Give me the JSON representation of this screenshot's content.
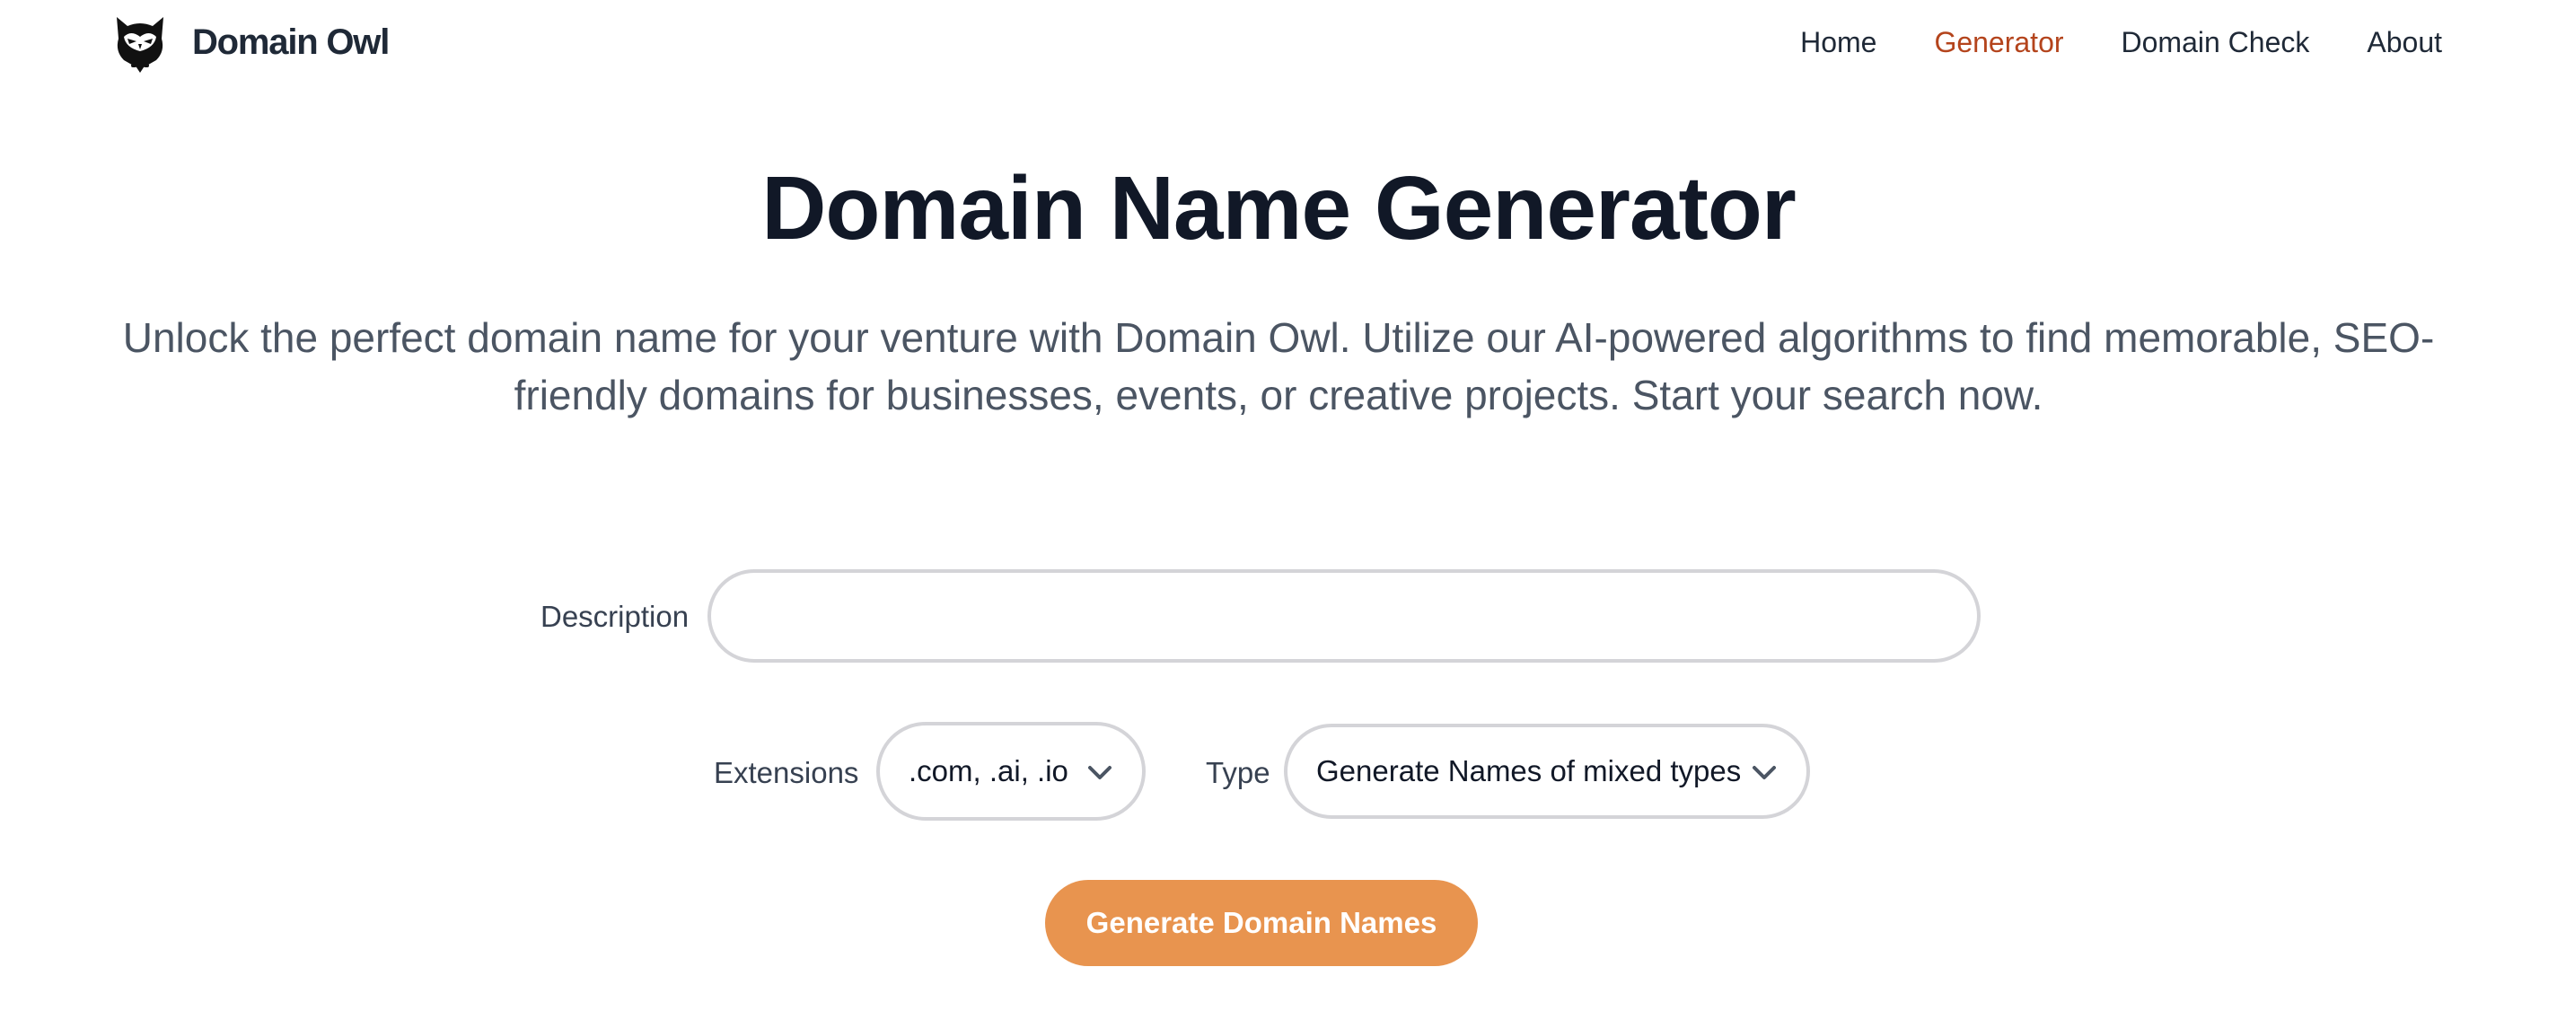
{
  "header": {
    "brand_name": "Domain Owl",
    "logo_icon": "owl-icon",
    "nav": [
      {
        "label": "Home",
        "active": false
      },
      {
        "label": "Generator",
        "active": true
      },
      {
        "label": "Domain Check",
        "active": false
      },
      {
        "label": "About",
        "active": false
      }
    ]
  },
  "hero": {
    "title": "Domain Name Generator",
    "subtitle": "Unlock the perfect domain name for your venture with Domain Owl. Utilize our AI-powered algorithms to find memorable, SEO-friendly domains for businesses, events, or creative projects. Start your search now."
  },
  "form": {
    "description_label": "Description",
    "description_value": "",
    "description_placeholder": "",
    "extensions_label": "Extensions",
    "extensions_value": ".com, .ai, .io",
    "type_label": "Type",
    "type_value": "Generate Names of mixed types",
    "submit_label": "Generate Domain Names"
  },
  "colors": {
    "accent": "#e8944f",
    "nav_active": "#b4441c",
    "text_dark": "#111827",
    "text_muted": "#4b5563",
    "border": "#d4d4d8"
  }
}
